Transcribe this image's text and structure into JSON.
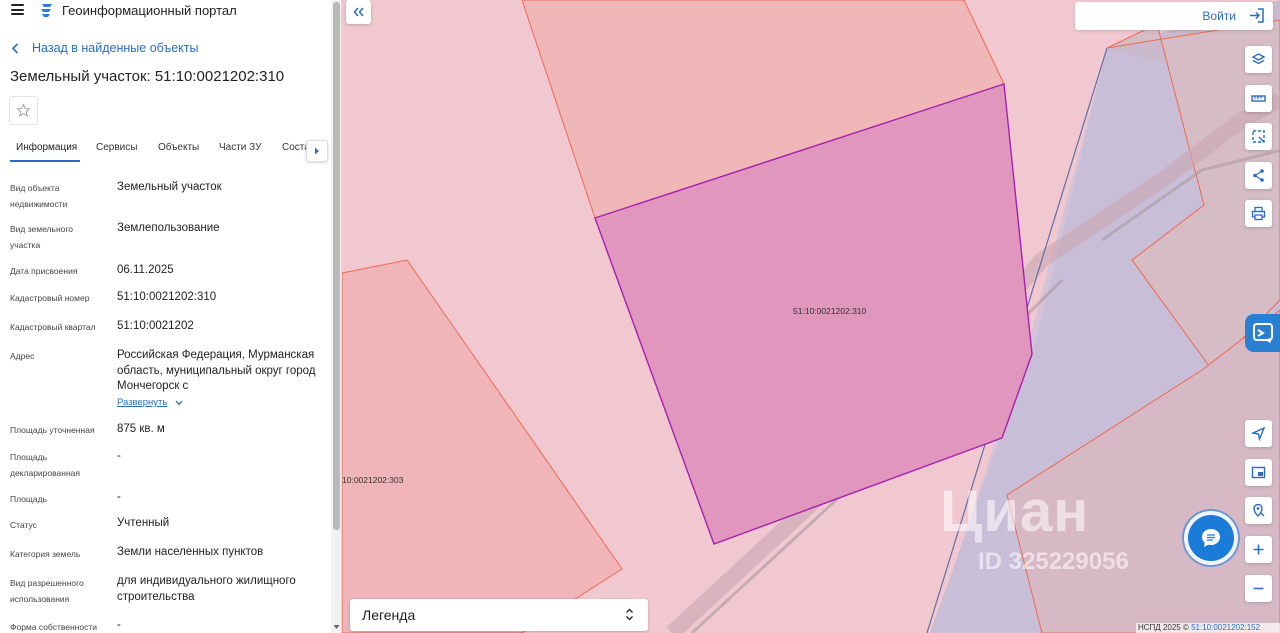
{
  "app": {
    "title": "Геоинформационный портал"
  },
  "nav": {
    "back_label": "Назад в найденные объекты"
  },
  "object": {
    "title": "Земельный участок: 51:10:0021202:310"
  },
  "tabs": [
    "Информация",
    "Сервисы",
    "Объекты",
    "Части ЗУ",
    "Соста"
  ],
  "active_tab": "Информация",
  "info": {
    "rows": [
      {
        "label": "Вид объекта недвижимости",
        "value": "Земельный участок"
      },
      {
        "label": "Вид земельного участка",
        "value": "Землепользование"
      },
      {
        "label": "Дата присвоения",
        "value": "06.11.2025"
      },
      {
        "label": "Кадастровый номер",
        "value": "51:10:0021202:310"
      },
      {
        "label": "Кадастровый квартал",
        "value": "51:10:0021202"
      },
      {
        "label": "Адрес",
        "value": "Российская Федерация, Мурманская область, муниципальный округ город Мончегорск с"
      },
      {
        "label": "Площадь уточненная",
        "value": "875 кв. м"
      },
      {
        "label": "Площадь декларированная",
        "value": "-"
      },
      {
        "label": "Площадь",
        "value": "-"
      },
      {
        "label": "Статус",
        "value": "Учтенный"
      },
      {
        "label": "Категория земель",
        "value": "Земли населенных пунктов"
      },
      {
        "label": "Вид разрешенного использования",
        "value": "для индивидуального жилищного строительства"
      },
      {
        "label": "Форма собственности",
        "value": "-"
      }
    ],
    "expand_label": "Развернуть"
  },
  "map": {
    "parcel_label": "51:10:0021202:310",
    "neighbor_label": "10:0021202:303",
    "login_label": "Войти",
    "legend_label": "Легенда",
    "watermark_brand": "Циан",
    "watermark_id": "ID 325229056",
    "attribution_text": "НСПД 2025 ©",
    "attribution_cad": "51:10:0021202:152",
    "tool_icons": [
      "layers-icon",
      "ruler-icon",
      "select-area-icon",
      "share-icon",
      "print-icon"
    ],
    "bottom_icons": [
      "locate-icon",
      "minimap-icon",
      "location-search-icon",
      "zoom-in-icon",
      "zoom-out-icon"
    ]
  },
  "colors": {
    "accent": "#2b6cc4",
    "selected_parcel_fill": "#e096bd",
    "selected_parcel_stroke": "#a81fb0",
    "parcel_stroke": "#ef6a50",
    "map_background": "#f1c8d0"
  }
}
